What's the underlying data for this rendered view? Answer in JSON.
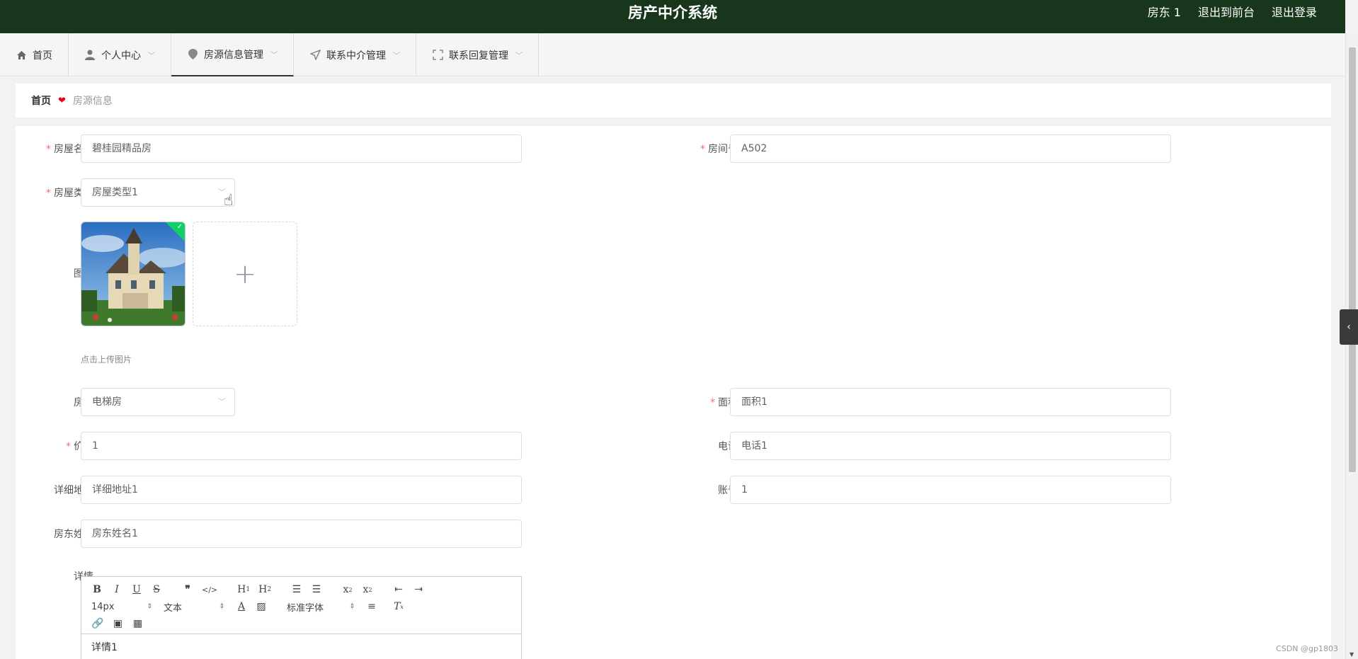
{
  "header": {
    "title": "房产中介系统",
    "user": "房东 1",
    "back_front": "退出到前台",
    "logout": "退出登录"
  },
  "nav": {
    "items": [
      {
        "label": "首页",
        "icon": "home-icon"
      },
      {
        "label": "个人中心",
        "icon": "user-icon"
      },
      {
        "label": "房源信息管理",
        "icon": "location-icon"
      },
      {
        "label": "联系中介管理",
        "icon": "send-icon"
      },
      {
        "label": "联系回复管理",
        "icon": "fullscreen-icon"
      }
    ]
  },
  "breadcrumb": {
    "home": "首页",
    "current": "房源信息"
  },
  "form": {
    "house_name": {
      "label": "房屋名称",
      "value": "碧桂园精品房"
    },
    "room_no": {
      "label": "房间号",
      "value": "A502"
    },
    "house_type": {
      "label": "房屋类型",
      "value": "房屋类型1"
    },
    "image": {
      "label": "图片",
      "tip": "点击上传图片"
    },
    "layout": {
      "label": "房型",
      "value": "电梯房"
    },
    "area": {
      "label": "面积",
      "value": "面积1"
    },
    "price": {
      "label": "价格",
      "value": "1"
    },
    "phone": {
      "label": "电话",
      "value": "电话1"
    },
    "address": {
      "label": "详细地址",
      "value": "详细地址1"
    },
    "account": {
      "label": "账号",
      "value": "1"
    },
    "landlord": {
      "label": "房东姓名",
      "value": "房东姓名1"
    },
    "detail": {
      "label": "详情",
      "value": "详情1"
    }
  },
  "editor": {
    "font_size": "14px",
    "header_picker": "文本",
    "font_family": "标准字体"
  },
  "watermark": "CSDN @gp1803"
}
